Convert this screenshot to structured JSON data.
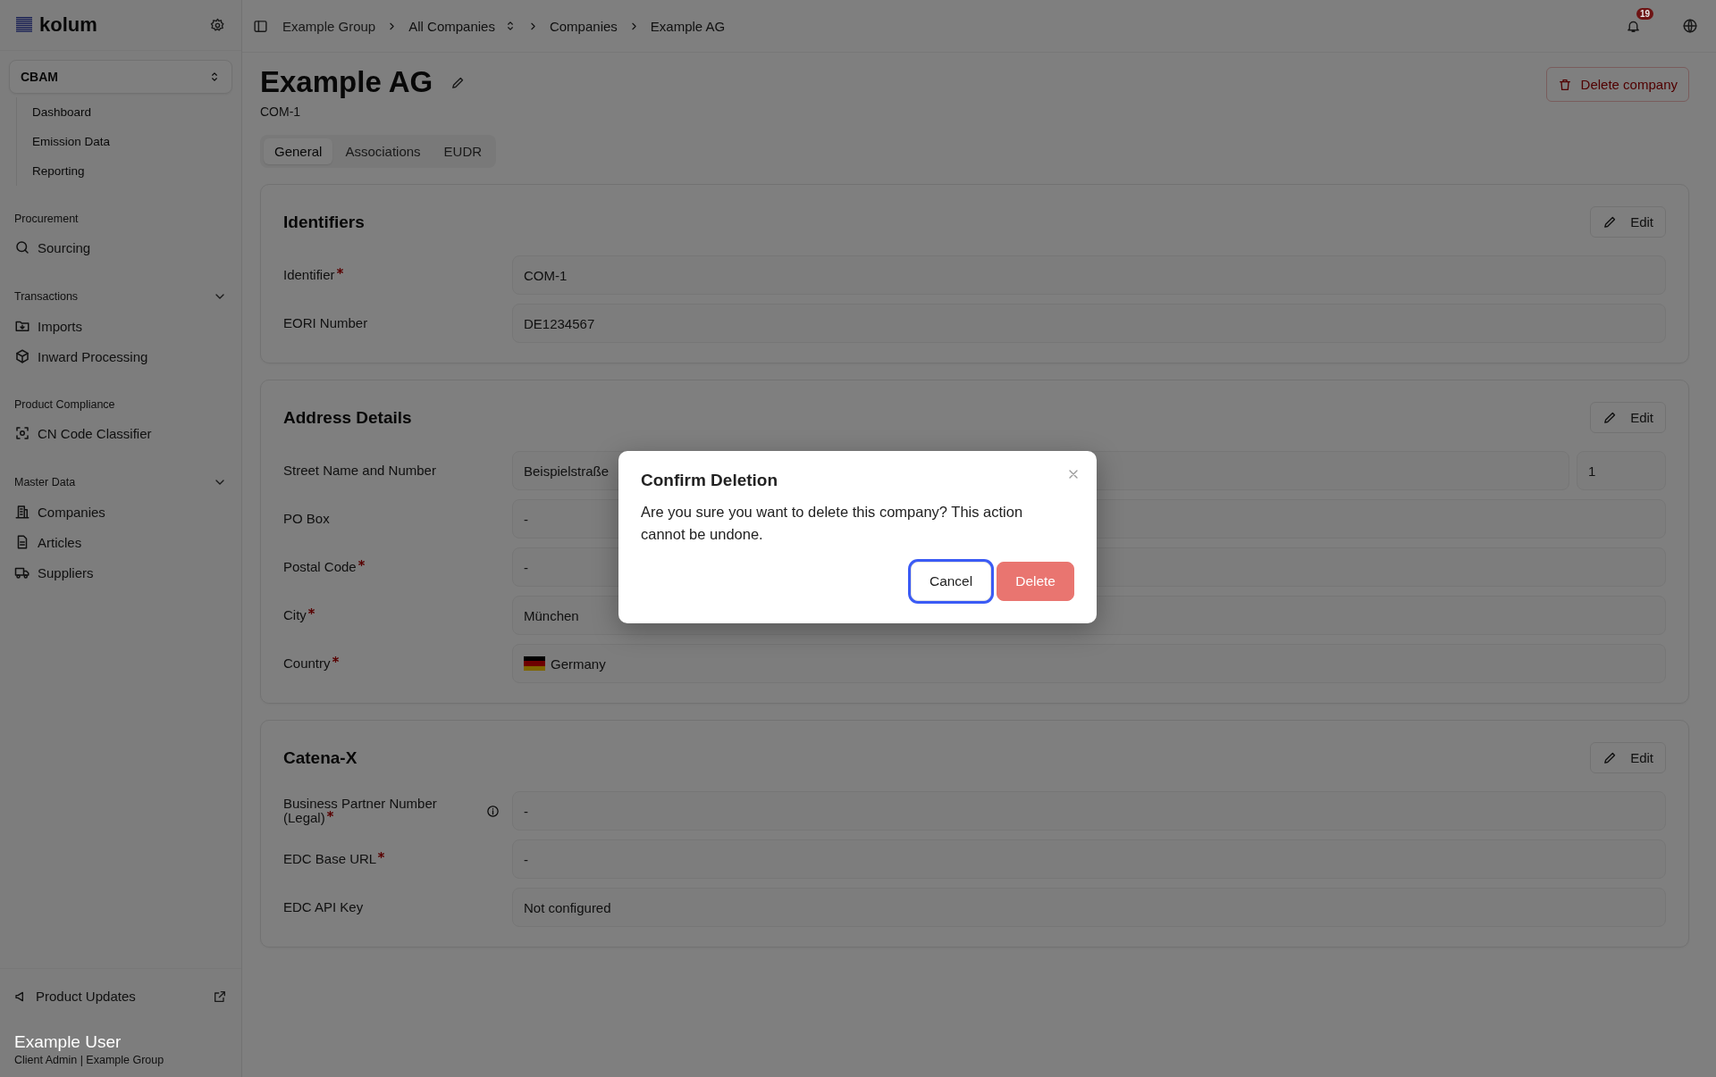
{
  "sidebar": {
    "logo": "kolum",
    "module": "CBAM",
    "module_items": [
      "Dashboard",
      "Emission Data",
      "Reporting"
    ],
    "sections": [
      {
        "title": "Procurement",
        "collapsible": false,
        "items": [
          "Sourcing"
        ]
      },
      {
        "title": "Transactions",
        "collapsible": true,
        "items": [
          "Imports",
          "Inward Processing"
        ]
      },
      {
        "title": "Product Compliance",
        "collapsible": false,
        "items": [
          "CN Code Classifier"
        ]
      },
      {
        "title": "Master Data",
        "collapsible": true,
        "items": [
          "Companies",
          "Articles",
          "Suppliers"
        ]
      }
    ],
    "footer_link": "Product Updates",
    "user": {
      "name": "Example User",
      "role": "Client Admin | Example Group"
    }
  },
  "breadcrumbs": [
    {
      "label": "Example Group",
      "kind": "muted"
    },
    {
      "label": "All Companies",
      "kind": "switcher"
    },
    {
      "label": "Companies",
      "kind": "link"
    },
    {
      "label": "Example AG",
      "kind": "current"
    }
  ],
  "notifications": "19",
  "page": {
    "title": "Example AG",
    "subtitle": "COM-1",
    "delete_button": "Delete company"
  },
  "tabs": [
    {
      "label": "General",
      "selected": true
    },
    {
      "label": "Associations",
      "selected": false
    },
    {
      "label": "EUDR",
      "selected": false
    }
  ],
  "cards": [
    {
      "title": "Identifiers",
      "edit": "Edit",
      "rows": [
        {
          "label": "Identifier",
          "required": true,
          "info": false,
          "kind": "text",
          "value": "COM-1"
        },
        {
          "label": "EORI Number",
          "required": false,
          "info": false,
          "kind": "text",
          "value": "DE1234567"
        }
      ]
    },
    {
      "title": "Address Details",
      "edit": "Edit",
      "rows": [
        {
          "label": "Street Name and Number",
          "required": false,
          "info": false,
          "kind": "split",
          "value": "Beispielstraße",
          "value_2": "1"
        },
        {
          "label": "PO Box",
          "required": false,
          "info": false,
          "kind": "text",
          "value": "-"
        },
        {
          "label": "Postal Code",
          "required": true,
          "info": false,
          "kind": "text",
          "value": "-"
        },
        {
          "label": "City",
          "required": true,
          "info": false,
          "kind": "text",
          "value": "München"
        },
        {
          "label": "Country",
          "required": true,
          "info": false,
          "kind": "country",
          "value": "Germany"
        }
      ]
    },
    {
      "title": "Catena-X",
      "edit": "Edit",
      "rows": [
        {
          "label": "Business Partner Number (Legal)",
          "required": true,
          "info": true,
          "kind": "text",
          "value": "-"
        },
        {
          "label": "EDC Base URL",
          "required": true,
          "info": false,
          "kind": "text",
          "value": "-"
        },
        {
          "label": "EDC API Key",
          "required": false,
          "info": false,
          "kind": "text",
          "value": "Not configured"
        }
      ]
    }
  ],
  "dialog": {
    "title": "Confirm Deletion",
    "message": "Are you sure you want to delete this company? This action cannot be undone.",
    "buttons": [
      {
        "label": "Cancel",
        "kind": "secondary",
        "focused": true
      },
      {
        "label": "Delete",
        "kind": "danger",
        "focused": false
      }
    ]
  }
}
